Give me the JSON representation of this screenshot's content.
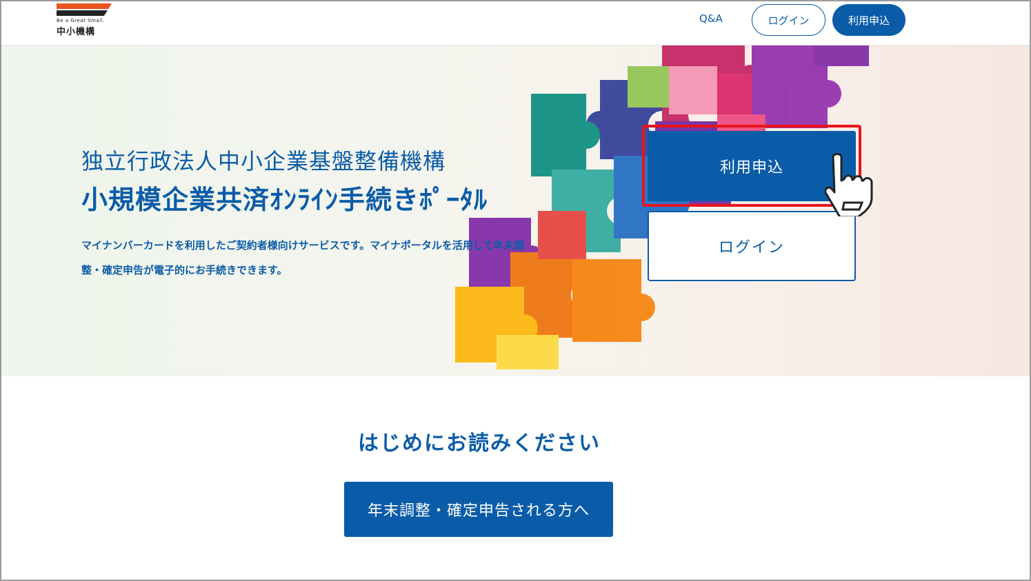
{
  "header": {
    "logo": {
      "tagline": "Be a Great Small.",
      "name": "中小機構"
    },
    "nav": {
      "qa": "Q&A",
      "login": "ログイン",
      "apply": "利用申込"
    }
  },
  "hero": {
    "subtitle": "独立行政法人中小企業基盤整備機構",
    "title": "小規模企業共済ｵﾝﾗｲﾝ手続きﾎﾟｰﾀﾙ",
    "description": "マイナンバーカードを利用したご契約者様向けサービスです。マイナポータルを活用して年末調整・確定申告が電子的にお手続きできます。",
    "apply_button": "利用申込",
    "login_button": "ログイン",
    "highlight_color": "#e8141b"
  },
  "intro": {
    "heading": "はじめにお読みください",
    "cta_button": "年末調整・確定申告される方へ"
  },
  "colors": {
    "primary": "#0b5ca8",
    "accent": "#e9541c"
  },
  "icons": [
    "pointing-hand-icon"
  ]
}
